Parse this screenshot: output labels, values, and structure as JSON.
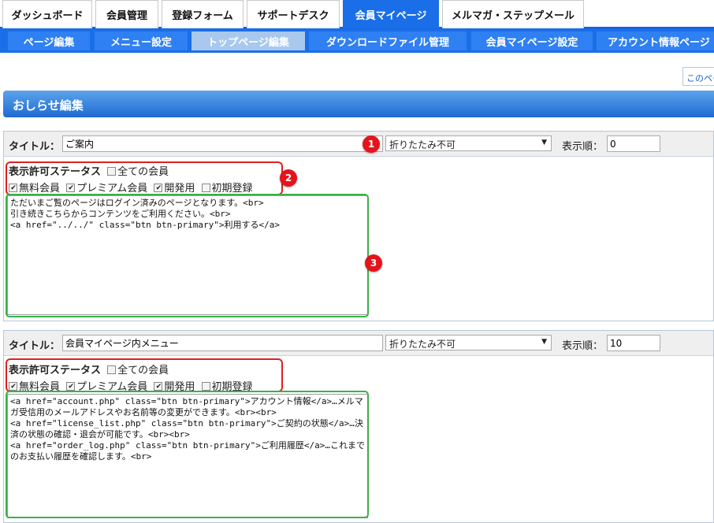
{
  "top_tabs": [
    {
      "label": "ダッシュボード",
      "active": false
    },
    {
      "label": "会員管理",
      "active": false
    },
    {
      "label": "登録フォーム",
      "active": false
    },
    {
      "label": "サポートデスク",
      "active": false
    },
    {
      "label": "会員マイページ",
      "active": true
    },
    {
      "label": "メルマガ・ステップメール",
      "active": false
    }
  ],
  "sub_nav": [
    {
      "label": "ページ編集",
      "active": false
    },
    {
      "label": "メニュー設定",
      "active": false
    },
    {
      "label": "トップページ編集",
      "active": true
    },
    {
      "label": "ダウンロードファイル管理",
      "active": false
    },
    {
      "label": "会員マイページ設定",
      "active": false
    },
    {
      "label": "アカウント情報ページ",
      "active": false
    }
  ],
  "page_link": "このペー",
  "section_title": "おしらせ編集",
  "labels": {
    "title": "タイトル：",
    "order": "表示順：",
    "status": "表示許可ステータス",
    "all_members": "全ての会員",
    "free": "無料会員",
    "premium": "プレミアム会員",
    "dev": "開発用",
    "initial": "初期登録"
  },
  "blocks": [
    {
      "title_value": "ご案内",
      "collapse_option": "折りたたみ不可",
      "order_value": "0",
      "checks": {
        "all": false,
        "free": true,
        "premium": true,
        "dev": true,
        "initial": false
      },
      "body": "ただいまご覧のページはログイン済みのページとなります。<br>\n引き続きこちらからコンテンツをご利用ください。<br>\n<a href=\"../../\" class=\"btn btn-primary\">利用する</a>"
    },
    {
      "title_value": "会員マイページ内メニュー",
      "collapse_option": "折りたたみ不可",
      "order_value": "10",
      "checks": {
        "all": false,
        "free": true,
        "premium": true,
        "dev": true,
        "initial": false
      },
      "body": "<a href=\"account.php\" class=\"btn btn-primary\">アカウント情報</a>…メルマガ受信用のメールアドレスやお名前等の変更ができます。<br><br>\n<a href=\"license_list.php\" class=\"btn btn-primary\">ご契約の状態</a>…決済の状態の確認・退会が可能です。<br><br>\n<a href=\"order_log.php\" class=\"btn btn-primary\">ご利用履歴</a>…これまでのお支払い履歴を確認します。<br>"
    }
  ],
  "badges": [
    "1",
    "2",
    "3"
  ],
  "colors": {
    "accent": "#1a6fe8",
    "badge": "#e5141b",
    "highlight_red": "#e02020",
    "highlight_green": "#3cb04a"
  }
}
